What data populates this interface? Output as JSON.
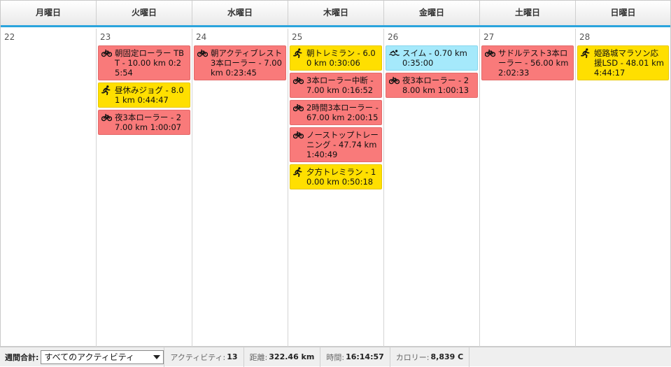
{
  "weekdays": [
    "月曜日",
    "火曜日",
    "水曜日",
    "木曜日",
    "金曜日",
    "土曜日",
    "日曜日"
  ],
  "days": [
    {
      "num": "22",
      "events": []
    },
    {
      "num": "23",
      "events": [
        {
          "type": "bike",
          "icon": "bike-icon",
          "text": "朝固定ローラー TBT - 10.00 km 0:25:54"
        },
        {
          "type": "run",
          "icon": "run-icon",
          "text": "昼休みジョグ - 8.01 km 0:44:47"
        },
        {
          "type": "bike",
          "icon": "bike-icon",
          "text": "夜3本ローラー - 27.00 km 1:00:07"
        }
      ]
    },
    {
      "num": "24",
      "events": [
        {
          "type": "bike",
          "icon": "bike-icon",
          "text": "朝アクティブレスト3本ローラー - 7.00 km 0:23:45"
        }
      ]
    },
    {
      "num": "25",
      "events": [
        {
          "type": "run",
          "icon": "run-icon",
          "text": "朝トレミラン - 6.00 km 0:30:06"
        },
        {
          "type": "bike",
          "icon": "bike-icon",
          "text": "3本ローラー中断 - 7.00 km 0:16:52"
        },
        {
          "type": "bike",
          "icon": "bike-icon",
          "text": "2時間3本ローラー - 67.00 km 2:00:15"
        },
        {
          "type": "bike",
          "icon": "bike-icon",
          "text": "ノーストップトレーニング - 47.74 km 1:40:49"
        },
        {
          "type": "run",
          "icon": "run-icon",
          "text": "夕方トレミラン - 10.00 km 0:50:18"
        }
      ]
    },
    {
      "num": "26",
      "events": [
        {
          "type": "swim",
          "icon": "swim-icon",
          "text": "スイム - 0.70 km 0:35:00"
        },
        {
          "type": "bike",
          "icon": "bike-icon",
          "text": "夜3本ローラー - 28.00 km 1:00:13"
        }
      ]
    },
    {
      "num": "27",
      "events": [
        {
          "type": "bike",
          "icon": "bike-icon",
          "text": "サドルテスト3本ローラー - 56.00 km 2:02:33"
        }
      ]
    },
    {
      "num": "28",
      "events": [
        {
          "type": "run",
          "icon": "run-icon",
          "text": "姫路城マラソン応援LSD - 48.01 km 4:44:17"
        }
      ]
    }
  ],
  "footer": {
    "label": "週間合計:",
    "filter_value": "すべてのアクティビティ",
    "activities_label": "アクティビティ:",
    "activities_value": "13",
    "distance_label": "距離:",
    "distance_value": "322.46 km",
    "time_label": "時間:",
    "time_value": "16:14:57",
    "calories_label": "カロリー:",
    "calories_value": "8,839 C"
  },
  "colors": {
    "bike": "#f97a7a",
    "run": "#ffdf00",
    "swim": "#a5e9fb",
    "accent": "#2aa4dd"
  }
}
